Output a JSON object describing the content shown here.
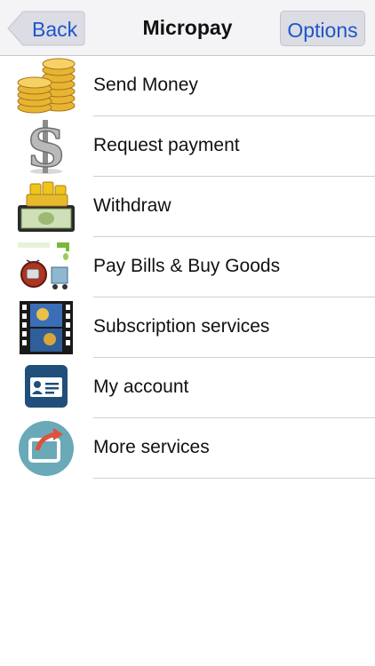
{
  "navbar": {
    "back_label": "Back",
    "title": "Micropay",
    "options_label": "Options",
    "accent_color": "#1c57c9"
  },
  "menu": {
    "items": [
      {
        "label": "Send Money",
        "icon": "gold-coins-icon"
      },
      {
        "label": "Request payment",
        "icon": "dollar-sign-icon"
      },
      {
        "label": "Withdraw",
        "icon": "cash-stack-icon"
      },
      {
        "label": "Pay Bills & Buy Goods",
        "icon": "bills-goods-icon"
      },
      {
        "label": "Subscription services",
        "icon": "film-strip-icon"
      },
      {
        "label": "My account",
        "icon": "id-card-icon"
      },
      {
        "label": "More services",
        "icon": "share-arrow-icon"
      }
    ]
  }
}
